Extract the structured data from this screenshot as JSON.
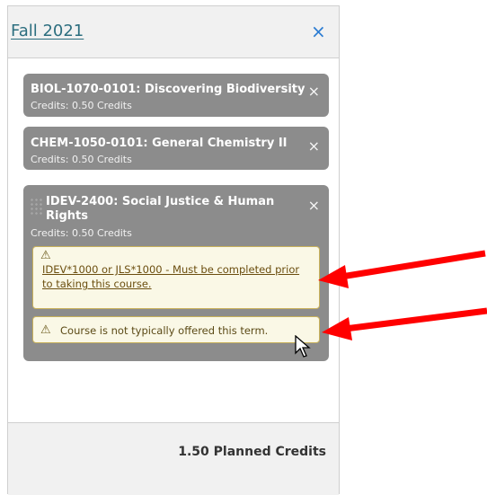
{
  "term": {
    "title": "Fall 2021",
    "close_symbol": "×"
  },
  "courses": [
    {
      "title": "BIOL-1070-0101: Discovering Biodiversity",
      "credits": "Credits: 0.50 Credits",
      "remove_symbol": "×"
    },
    {
      "title": "CHEM-1050-0101: General Chemistry II",
      "credits": "Credits: 0.50 Credits",
      "remove_symbol": "×"
    },
    {
      "title": "IDEV-2400: Social Justice & Human Rights",
      "credits": "Credits: 0.50 Credits",
      "remove_symbol": "×",
      "warnings": [
        {
          "icon": "warning-icon",
          "symbol": "⚠",
          "text": "IDEV*1000 or JLS*1000 - Must be completed prior to taking this course."
        },
        {
          "icon": "warning-icon",
          "symbol": "⚠",
          "text": "Course is not typically offered this term."
        }
      ]
    }
  ],
  "footer": {
    "planned_credits": "1.50 Planned Credits"
  },
  "colors": {
    "accent": "#2c6e7f",
    "course_bg": "#8c8c8c",
    "warning_bg": "#faf8e6",
    "arrow": "#ff0000"
  }
}
